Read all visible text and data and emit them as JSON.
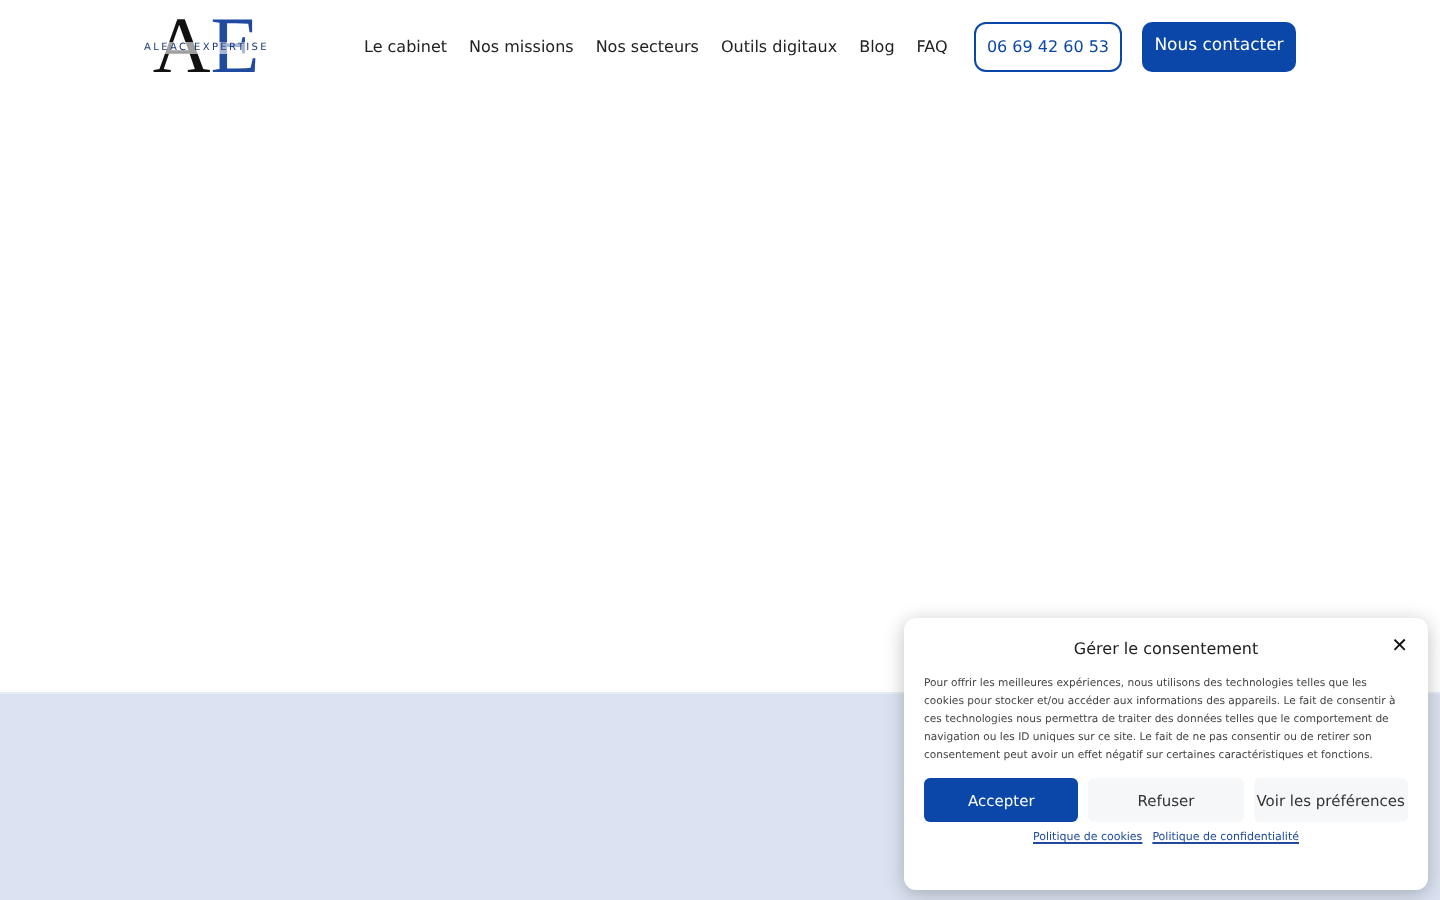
{
  "header": {
    "logo": {
      "letters": [
        "A",
        "E"
      ],
      "name": "ALEAC EXPERTISE"
    },
    "nav": [
      "Le cabinet",
      "Nos missions",
      "Nos secteurs",
      "Outils digitaux",
      "Blog",
      "FAQ"
    ],
    "phone_button": "06 69 42 60 53",
    "contact_button": "Nous contacter"
  },
  "consent_dialog": {
    "title": "Gérer le consentement",
    "close": "✕",
    "text": "Pour offrir les meilleures expériences, nous utilisons des technologies telles que les cookies pour stocker et/ou accéder aux informations des appareils. Le fait de consentir à ces technologies nous permettra de traiter des données telles que le comportement de navigation ou les ID uniques sur ce site. Le fait de ne pas consentir ou de retirer son consentement peut avoir un effet négatif sur certaines caractéristiques et fonctions.",
    "buttons": [
      {
        "label": "Accepter",
        "kind": "primary"
      },
      {
        "label": "Refuser",
        "kind": "secondary"
      },
      {
        "label": "Voir les préférences",
        "kind": "secondary"
      }
    ],
    "links": [
      "Politique de cookies",
      "Politique de confidentialité"
    ]
  }
}
